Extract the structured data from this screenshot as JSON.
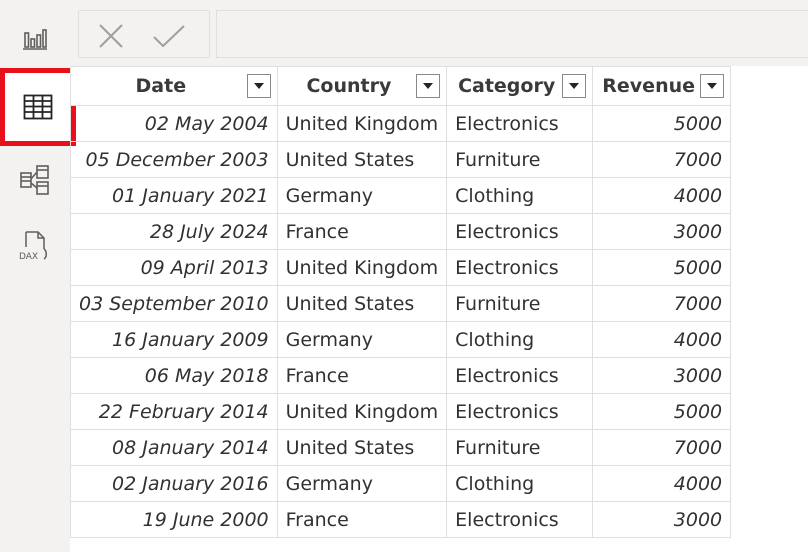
{
  "rail": {
    "items": [
      {
        "name": "report-view",
        "icon": "bar-chart-icon",
        "active": false
      },
      {
        "name": "table-view",
        "icon": "table-grid-icon",
        "active": true
      },
      {
        "name": "model-view",
        "icon": "model-diagram-icon",
        "active": false
      },
      {
        "name": "dax-query-view",
        "icon": "dax-document-icon",
        "active": false,
        "icon_text": "DAX"
      }
    ],
    "highlight_color": "#e8101a"
  },
  "formula_bar": {
    "cancel_icon": "close-icon",
    "commit_icon": "checkmark-icon",
    "value": ""
  },
  "table": {
    "columns": [
      "Date",
      "Country",
      "Category",
      "Revenue"
    ],
    "rows": [
      [
        "02 May 2004",
        "United Kingdom",
        "Electronics",
        "5000"
      ],
      [
        "05 December 2003",
        "United States",
        "Furniture",
        "7000"
      ],
      [
        "01 January 2021",
        "Germany",
        "Clothing",
        "4000"
      ],
      [
        "28 July 2024",
        "France",
        "Electronics",
        "3000"
      ],
      [
        "09 April 2013",
        "United Kingdom",
        "Electronics",
        "5000"
      ],
      [
        "03 September 2010",
        "United States",
        "Furniture",
        "7000"
      ],
      [
        "16 January 2009",
        "Germany",
        "Clothing",
        "4000"
      ],
      [
        "06 May 2018",
        "France",
        "Electronics",
        "3000"
      ],
      [
        "22 February 2014",
        "United Kingdom",
        "Electronics",
        "5000"
      ],
      [
        "08 January 2014",
        "United States",
        "Furniture",
        "7000"
      ],
      [
        "02 January 2016",
        "Germany",
        "Clothing",
        "4000"
      ],
      [
        "19 June 2000",
        "France",
        "Electronics",
        "3000"
      ]
    ]
  }
}
